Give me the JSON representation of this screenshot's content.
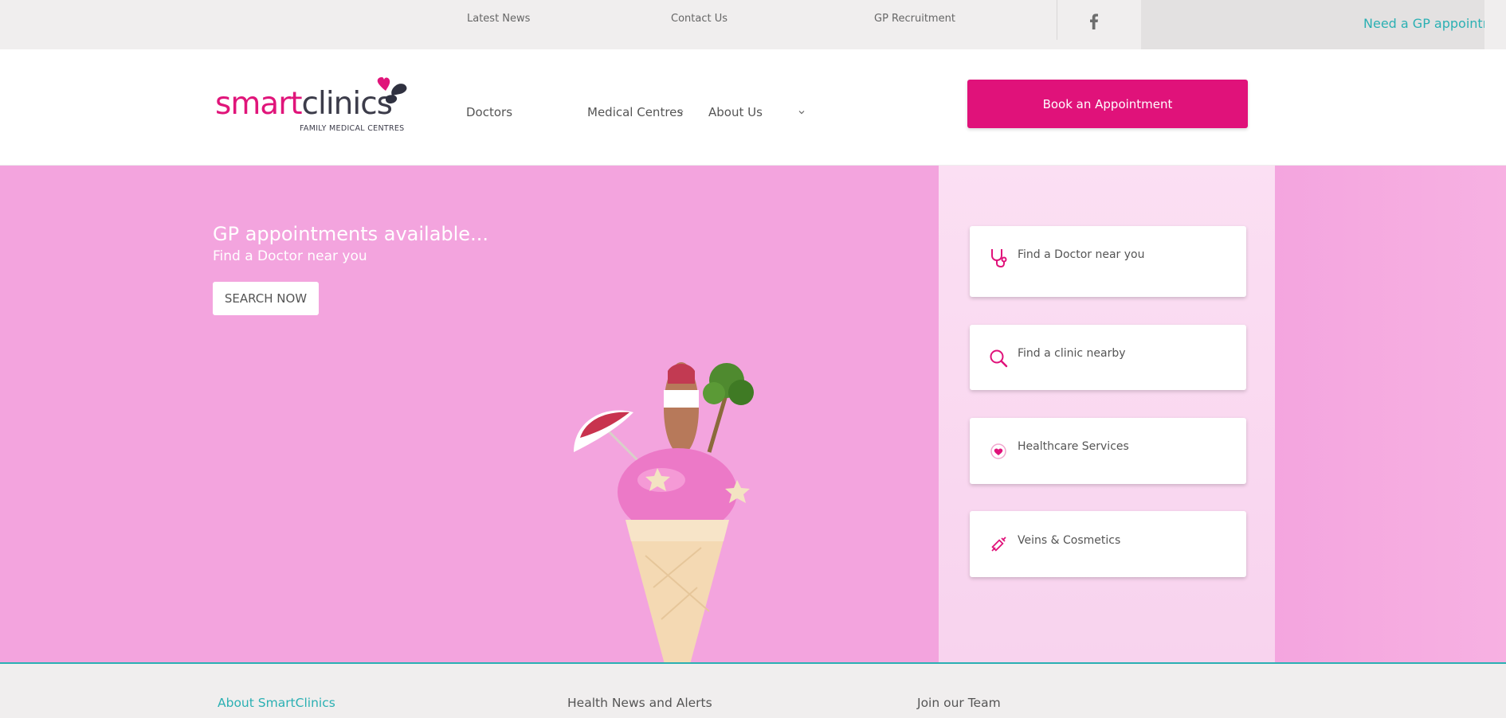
{
  "topbar": {
    "links": [
      "Latest News",
      "Contact Us",
      "GP Recruitment"
    ],
    "appointment_cta": "Need a GP appointment"
  },
  "header": {
    "logo": {
      "word_smart": "smart",
      "word_clinics": "clinics",
      "subtitle": "FAMILY MEDICAL CENTRES"
    },
    "nav": [
      "Doctors",
      "Medical Centres",
      "About Us"
    ],
    "book_button": "Book an Appointment"
  },
  "hero": {
    "heading": "GP appointments available...",
    "subheading": "Find a Doctor near you",
    "search_button": "SEARCH NOW"
  },
  "quick_links": [
    {
      "label": "Find a Doctor near you",
      "icon": "stethoscope-icon"
    },
    {
      "label": "Find a clinic nearby",
      "icon": "search-icon"
    },
    {
      "label": "Healthcare Services",
      "icon": "heart-chat-icon"
    },
    {
      "label": "Veins & Cosmetics",
      "icon": "syringe-icon"
    }
  ],
  "footer": {
    "links": [
      "About SmartClinics",
      "Health News and Alerts",
      "Join our Team"
    ]
  },
  "colors": {
    "brand_pink": "#e0127a",
    "teal": "#2bb0b3",
    "hero_pink": "#f3a4de",
    "panel_pink": "#fbdff3"
  }
}
